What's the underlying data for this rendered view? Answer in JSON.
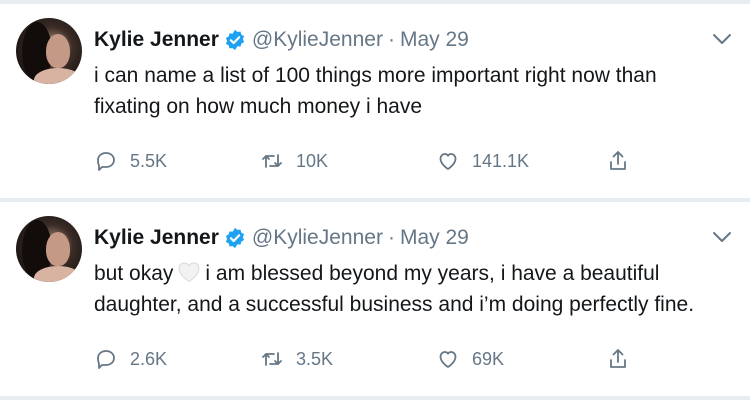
{
  "colors": {
    "verified_blue": "#1da1f2",
    "secondary_text": "#657786",
    "primary_text": "#14171a",
    "background": "#e6ecf0"
  },
  "tweets": [
    {
      "author": "Kylie Jenner",
      "handle": "@KylieJenner",
      "separator": "·",
      "date": "May 29",
      "text": "i can name a list of 100 things more important right now than fixating on how much money i have",
      "replies": "5.5K",
      "retweets": "10K",
      "likes": "141.1K"
    },
    {
      "author": "Kylie Jenner",
      "handle": "@KylieJenner",
      "separator": "·",
      "date": "May 29",
      "text_before_emoji": "but okay",
      "emoji": "white-heart",
      "text_after_emoji": "i am blessed beyond my years, i have a beautiful daughter, and a successful business and i’m doing perfectly fine.",
      "replies": "2.6K",
      "retweets": "3.5K",
      "likes": "69K"
    }
  ],
  "icons": {
    "verified": "verified-badge-icon",
    "caret": "chevron-down-icon",
    "reply": "reply-icon",
    "retweet": "retweet-icon",
    "like": "heart-icon",
    "share": "share-icon"
  }
}
